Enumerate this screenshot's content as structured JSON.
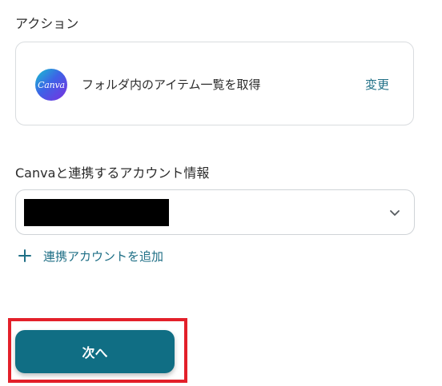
{
  "action_section": {
    "label": "アクション",
    "card": {
      "logo_text": "Canva",
      "title": "フォルダ内のアイテム一覧を取得",
      "change_link": "変更"
    }
  },
  "account_section": {
    "label": "Canvaと連携するアカウント情報",
    "selected_value": "[redacted]",
    "chevron_icon": "chevron-down-icon",
    "add_account_icon": "plus-icon",
    "add_account_label": "連携アカウントを追加"
  },
  "footer": {
    "next_label": "次へ"
  },
  "colors": {
    "accent": "#1f6f86",
    "primary_button": "#106e84",
    "highlight": "#e3202a"
  }
}
